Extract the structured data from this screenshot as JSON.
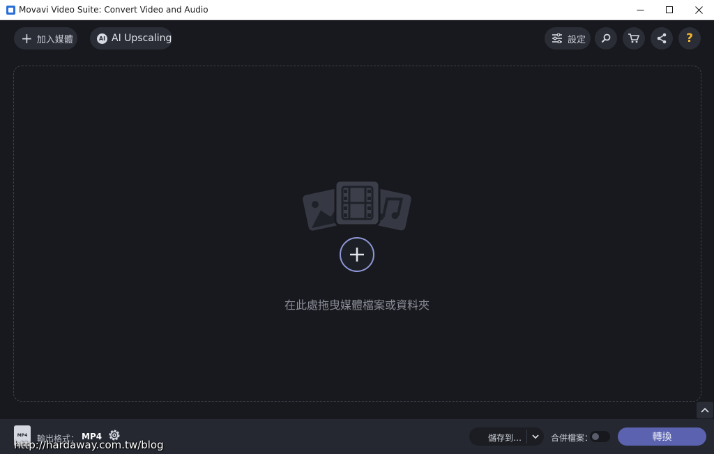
{
  "window": {
    "title": "Movavi Video Suite: Convert Video and Audio",
    "controls": [
      "minimize-icon",
      "maximize-icon",
      "close-icon"
    ]
  },
  "toolbar": {
    "add_media_label": "加入媒體",
    "ai_badge": "AI",
    "ai_upscaling_label": "AI Upscaling",
    "settings_label": "設定",
    "icons": [
      "search-icon",
      "cart-icon",
      "share-icon",
      "help-icon"
    ],
    "help_glyph": "?"
  },
  "dropzone": {
    "hint": "在此處拖曳媒體檔案或資料夾"
  },
  "bottom": {
    "format_badge": "MP4",
    "output_format_label": "輸出格式：",
    "output_format_value": "MP4",
    "save_to_label": "儲存到…",
    "merge_label": "合併檔案：",
    "merge_enabled": false,
    "convert_label": "轉換",
    "watermark": "http://hardaway.com.tw/blog"
  },
  "colors": {
    "background": "#18191e",
    "bar": "#252831",
    "accent": "#5b63b0",
    "help": "#f5b72e"
  }
}
